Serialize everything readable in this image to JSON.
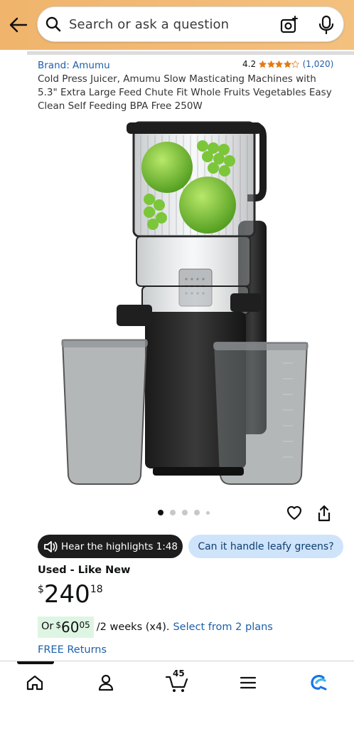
{
  "header": {
    "search_placeholder": "Search or ask a question"
  },
  "product": {
    "brand": "Brand: Amumu",
    "rating": "4.2",
    "rating_value": 4.2,
    "rating_count": "(1,020)",
    "title": "Cold Press Juicer, Amumu Slow Masticating Machines with 5.3\" Extra Large Feed Chute Fit Whole Fruits Vegetables Easy Clean Self Feeding BPA Free 250W",
    "image_count": 5,
    "active_image": 1
  },
  "actions": {
    "hear_highlights": "Hear the highlights 1:48",
    "question_pill": "Can it handle leafy greens?"
  },
  "pricing": {
    "condition": "Used - Like New",
    "currency": "$",
    "whole": "240",
    "fraction": "18",
    "plan_or": "Or",
    "plan_currency": "$",
    "plan_whole": "60",
    "plan_fraction": "05",
    "plan_terms": "/2 weeks (x4).",
    "plan_link": "Select from 2 plans",
    "returns": "FREE Returns"
  },
  "nav": {
    "cart_count": "45",
    "items": [
      "home-icon",
      "account-icon",
      "cart-icon",
      "menu-icon",
      "rufus-icon"
    ]
  },
  "colors": {
    "header_bg": "#f0b46c",
    "link": "#1e5fa8",
    "star": "#e47911",
    "plan_bg": "#dff5e4",
    "pill_light": "#cfe4fb"
  }
}
